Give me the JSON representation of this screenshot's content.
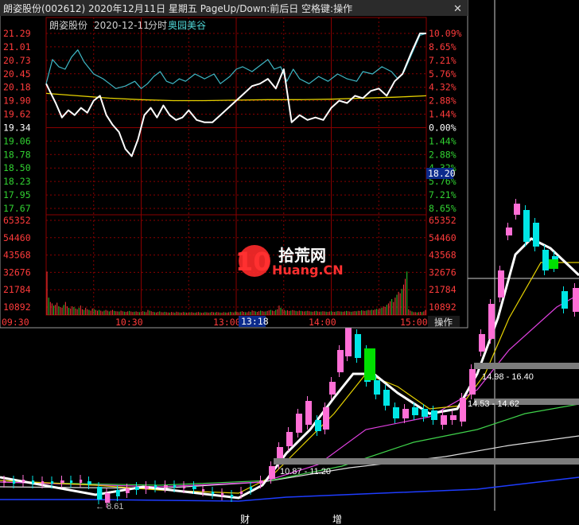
{
  "title_bar": {
    "text": "朗姿股份(002612)  2020年12月11日  星期五  PageUp/Down:前后日  空格键:操作",
    "close_glyph": "✕"
  },
  "minute_chart": {
    "header_name": "朗姿股份",
    "header_date": "2020-12-11",
    "header_mode": "分时",
    "header_tag": "奥园美谷",
    "op_button_label": "操作",
    "time_readout": "13:18",
    "price_readout": "18.20"
  },
  "watermark": {
    "number": "10",
    "cn": "拾荒网",
    "en": "Huang.CN"
  },
  "background_kline": {
    "labels": {
      "high_1": "16.40",
      "low_1": "14.98",
      "high_2": "14.62",
      "low_2": "14.53",
      "high_3": "11.20",
      "low_3": "10.87",
      "min": "8.61"
    },
    "event_markers": [
      "财",
      "增"
    ]
  },
  "chart_data": [
    {
      "type": "line",
      "name": "intraday-timeshare",
      "x_ticks": [
        "09:30",
        "10:30",
        "13:00",
        "14:00",
        "15:00"
      ],
      "price_ticks": [
        "21.29",
        "21.01",
        "20.73",
        "20.45",
        "20.18",
        "19.90",
        "19.62",
        "19.34",
        "19.06",
        "18.78",
        "18.50",
        "18.23",
        "17.95",
        "17.67"
      ],
      "pct_ticks": [
        "10.09%",
        "8.65%",
        "7.21%",
        "5.76%",
        "4.32%",
        "2.88%",
        "1.44%",
        "0.00%",
        "1.44%",
        "2.88%",
        "4.32%",
        "5.76%",
        "7.21%",
        "8.65%"
      ],
      "volume_ticks": [
        "65352",
        "54460",
        "43568",
        "32676",
        "21784",
        "10892"
      ],
      "ylim": [
        17.67,
        21.29
      ],
      "prev_close": 19.34,
      "price_x": [
        0,
        6,
        10,
        14,
        18,
        22,
        26,
        30,
        34,
        38,
        42,
        46,
        50,
        54,
        58,
        62,
        66,
        70,
        74,
        78,
        82,
        86,
        90,
        95,
        100,
        105,
        110,
        115,
        120,
        125,
        130,
        135,
        140,
        145,
        150,
        155,
        160,
        165,
        170,
        175,
        180,
        185,
        190,
        195,
        200,
        205,
        210,
        215,
        220,
        225,
        230,
        236,
        240
      ],
      "price": [
        20.25,
        19.85,
        19.55,
        19.7,
        19.6,
        19.75,
        19.65,
        19.9,
        20.0,
        19.6,
        19.4,
        19.25,
        18.9,
        18.75,
        19.1,
        19.6,
        19.75,
        19.55,
        19.8,
        19.6,
        19.5,
        19.55,
        19.7,
        19.5,
        19.45,
        19.45,
        19.6,
        19.75,
        19.9,
        20.05,
        20.2,
        20.25,
        20.35,
        20.15,
        20.55,
        19.45,
        19.6,
        19.5,
        19.55,
        19.5,
        19.75,
        19.9,
        19.85,
        20.0,
        19.95,
        20.1,
        20.15,
        20.0,
        20.3,
        20.45,
        20.85,
        21.29,
        21.29
      ],
      "avg_line_x": [
        0,
        20,
        40,
        60,
        80,
        100,
        120,
        140,
        160,
        180,
        200,
        220,
        240
      ],
      "avg_line": [
        20.05,
        20.0,
        19.95,
        19.92,
        19.9,
        19.9,
        19.91,
        19.92,
        19.92,
        19.93,
        19.95,
        19.97,
        20.0
      ],
      "lead_line_x": [
        0,
        4,
        8,
        12,
        16,
        20,
        24,
        30,
        36,
        40,
        44,
        50,
        56,
        60,
        64,
        68,
        72,
        76,
        80,
        84,
        88,
        94,
        100,
        106,
        110,
        116,
        120,
        124,
        130,
        136,
        140,
        144,
        148,
        152,
        156,
        160,
        166,
        172,
        178,
        184,
        190,
        196,
        200,
        206,
        212,
        218,
        222,
        226,
        230,
        236,
        240
      ],
      "lead_line": [
        20.25,
        20.75,
        20.6,
        20.55,
        20.8,
        20.95,
        20.7,
        20.45,
        20.35,
        20.25,
        20.15,
        20.2,
        20.3,
        20.15,
        20.25,
        20.4,
        20.5,
        20.3,
        20.25,
        20.35,
        20.3,
        20.45,
        20.35,
        20.45,
        20.25,
        20.4,
        20.55,
        20.6,
        20.5,
        20.65,
        20.75,
        20.55,
        20.6,
        20.3,
        20.55,
        20.35,
        20.25,
        20.4,
        20.3,
        20.45,
        20.35,
        20.3,
        20.5,
        20.45,
        20.6,
        20.5,
        20.35,
        20.5,
        20.8,
        21.25,
        21.29
      ],
      "volume_max": 65352,
      "volume": [
        30000,
        12000,
        9000,
        8000,
        6500,
        7000,
        8500,
        6000,
        5500,
        5000,
        7000,
        9000,
        6000,
        5000,
        4500,
        6000,
        5500,
        4500,
        4000,
        5000,
        6500,
        4000,
        3500,
        5000,
        4000,
        3500,
        3000,
        4500,
        4000,
        3500,
        3000,
        3500,
        3000,
        2500,
        3000,
        3500,
        3000,
        2500,
        3000,
        3500,
        2800,
        2600,
        2500,
        2400,
        3000,
        2600,
        2300,
        2200,
        2500,
        2800,
        2400,
        2100,
        2300,
        2500,
        2200,
        2000,
        2200,
        2600,
        2300,
        2000,
        3500,
        3000,
        2600,
        2200,
        2000,
        1800,
        2200,
        2500,
        2000,
        1900,
        2200,
        2000,
        1800,
        1700,
        2100,
        1900,
        1600,
        2300,
        2000,
        1800,
        1700,
        2100,
        1900,
        1700,
        1600,
        1800,
        2000,
        1700,
        1600,
        1900,
        2100,
        1800,
        1600,
        1700,
        2000,
        1900,
        1700,
        1800,
        2200,
        1900,
        1800,
        2100,
        1900,
        1700,
        1600,
        2000,
        1800,
        1700,
        1900,
        2200,
        2000,
        1800,
        2400,
        2100,
        1900,
        2300,
        2600,
        2200,
        2000,
        1900,
        2500,
        2200,
        3200,
        2800,
        2500,
        2200,
        2600,
        3000,
        2700,
        2400,
        2500,
        2800,
        3200,
        3500,
        3000,
        2700,
        3500,
        4000,
        6500,
        5000,
        4000,
        3500,
        3000,
        3200,
        2800,
        3000,
        3400,
        3100,
        2800,
        2600,
        3000,
        2800,
        2600,
        2500,
        2700,
        2900,
        2600,
        2400,
        2300,
        2600,
        2800,
        2500,
        2300,
        2400,
        2600,
        2500,
        2300,
        2200,
        2400,
        2600,
        2300,
        2200,
        2500,
        2700,
        2500,
        2400,
        2300,
        2500,
        2800,
        2600,
        2400,
        2300,
        2500,
        2700,
        2600,
        2900,
        2800,
        3200,
        3000,
        2800,
        3100,
        3500,
        3200,
        3600,
        3400,
        3800,
        4200,
        3900,
        4500,
        5000,
        6000,
        5500,
        7000,
        8000,
        9500,
        11000,
        9000,
        12000,
        14000,
        16000,
        15000,
        18000,
        21000,
        25000,
        30000,
        4000,
        3000,
        2500,
        2000,
        2000,
        1800,
        2000,
        2200,
        2000,
        2500,
        3500
      ]
    }
  ]
}
